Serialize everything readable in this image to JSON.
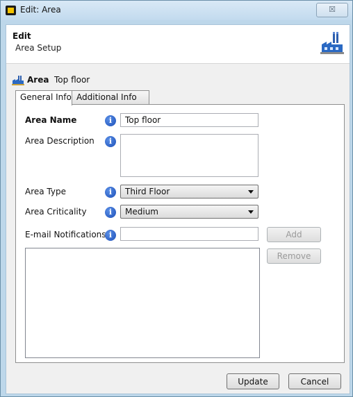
{
  "window": {
    "title": "Edit: Area",
    "close_glyph": "☒"
  },
  "header": {
    "title": "Edit",
    "subtitle": "Area Setup",
    "icon": "factory-icon"
  },
  "breadcrumb": {
    "label": "Area",
    "value": "Top floor",
    "icon": "factory-icon"
  },
  "tabs": [
    {
      "label": "General Info",
      "active": true
    },
    {
      "label": "Additional Info",
      "active": false
    }
  ],
  "form": {
    "area_name": {
      "label": "Area Name",
      "value": "Top floor"
    },
    "area_description": {
      "label": "Area Description",
      "value": ""
    },
    "area_type": {
      "label": "Area Type",
      "value": "Third Floor"
    },
    "area_criticality": {
      "label": "Area Criticality",
      "value": "Medium"
    },
    "email_notifications": {
      "label": "E-mail Notifications",
      "value": ""
    },
    "info_glyph": "i",
    "add_label": "Add",
    "remove_label": "Remove"
  },
  "footer": {
    "update_label": "Update",
    "cancel_label": "Cancel"
  },
  "colors": {
    "titlebar": "#c2daee",
    "info": "#1c4fb8",
    "accent": "#1f5fc9"
  }
}
